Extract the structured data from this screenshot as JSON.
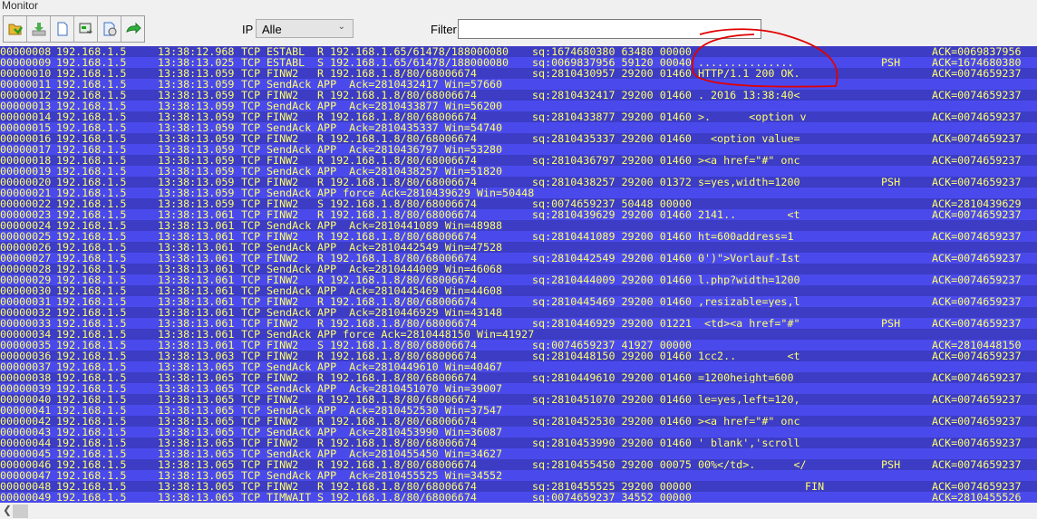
{
  "window": {
    "title": "Monitor"
  },
  "toolbar": {
    "buttons": [
      {
        "icon": "open-folder-icon"
      },
      {
        "icon": "download-icon"
      },
      {
        "icon": "new-document-icon"
      },
      {
        "icon": "export-icon"
      },
      {
        "icon": "properties-icon"
      },
      {
        "icon": "forward-arrow-icon"
      }
    ],
    "ip_label": "IP",
    "ip_value": "Alle",
    "filter_label": "Filter",
    "filter_value": ""
  },
  "colors": {
    "row_dark": "#3c3cc4",
    "row_light": "#4a4aec",
    "text": "#ffff70",
    "annotation": "#e00000"
  },
  "rows": [
    {
      "id": "00000008",
      "ip": "192.168.1.5",
      "time": "13:38:12.968",
      "proto": "TCP",
      "state": "ESTABL",
      "detail": "R 192.168.1.65/61478/188000080",
      "seq": "sq:1674680380 63480 00000",
      "flag": "",
      "ack": "ACK=0069837956"
    },
    {
      "id": "00000009",
      "ip": "192.168.1.5",
      "time": "13:38:13.025",
      "proto": "TCP",
      "state": "ESTABL",
      "detail": "S 192.168.1.65/61478/188000080",
      "seq": "sq:0069837956 59120 00040 ...............",
      "flag": "PSH",
      "ack": "ACK=1674680380"
    },
    {
      "id": "00000010",
      "ip": "192.168.1.5",
      "time": "13:38:13.059",
      "proto": "TCP",
      "state": "FINW2",
      "detail": "R 192.168.1.8/80/68006674",
      "seq": "sq:2810430957 29200 01460 HTTP/1.1 200 OK.",
      "flag": "",
      "ack": "ACK=0074659237"
    },
    {
      "id": "00000011",
      "ip": "192.168.1.5",
      "time": "13:38:13.059",
      "proto": "TCP",
      "state": "SendAck",
      "detail": "APP  Ack=2810432417 Win=57660",
      "seq": "",
      "flag": "",
      "ack": ""
    },
    {
      "id": "00000012",
      "ip": "192.168.1.5",
      "time": "13:38:13.059",
      "proto": "TCP",
      "state": "FINW2",
      "detail": "R 192.168.1.8/80/68006674",
      "seq": "sq:2810432417 29200 01460 . 2016 13:38:40<",
      "flag": "",
      "ack": "ACK=0074659237"
    },
    {
      "id": "00000013",
      "ip": "192.168.1.5",
      "time": "13:38:13.059",
      "proto": "TCP",
      "state": "SendAck",
      "detail": "APP  Ack=2810433877 Win=56200",
      "seq": "",
      "flag": "",
      "ack": ""
    },
    {
      "id": "00000014",
      "ip": "192.168.1.5",
      "time": "13:38:13.059",
      "proto": "TCP",
      "state": "FINW2",
      "detail": "R 192.168.1.8/80/68006674",
      "seq": "sq:2810433877 29200 01460 >.      <option v",
      "flag": "",
      "ack": "ACK=0074659237"
    },
    {
      "id": "00000015",
      "ip": "192.168.1.5",
      "time": "13:38:13.059",
      "proto": "TCP",
      "state": "SendAck",
      "detail": "APP  Ack=2810435337 Win=54740",
      "seq": "",
      "flag": "",
      "ack": ""
    },
    {
      "id": "00000016",
      "ip": "192.168.1.5",
      "time": "13:38:13.059",
      "proto": "TCP",
      "state": "FINW2",
      "detail": "R 192.168.1.8/80/68006674",
      "seq": "sq:2810435337 29200 01460   <option value=",
      "flag": "",
      "ack": "ACK=0074659237"
    },
    {
      "id": "00000017",
      "ip": "192.168.1.5",
      "time": "13:38:13.059",
      "proto": "TCP",
      "state": "SendAck",
      "detail": "APP  Ack=2810436797 Win=53280",
      "seq": "",
      "flag": "",
      "ack": ""
    },
    {
      "id": "00000018",
      "ip": "192.168.1.5",
      "time": "13:38:13.059",
      "proto": "TCP",
      "state": "FINW2",
      "detail": "R 192.168.1.8/80/68006674",
      "seq": "sq:2810436797 29200 01460 ><a href=\"#\" onc",
      "flag": "",
      "ack": "ACK=0074659237"
    },
    {
      "id": "00000019",
      "ip": "192.168.1.5",
      "time": "13:38:13.059",
      "proto": "TCP",
      "state": "SendAck",
      "detail": "APP  Ack=2810438257 Win=51820",
      "seq": "",
      "flag": "",
      "ack": ""
    },
    {
      "id": "00000020",
      "ip": "192.168.1.5",
      "time": "13:38:13.059",
      "proto": "TCP",
      "state": "FINW2",
      "detail": "R 192.168.1.8/80/68006674",
      "seq": "sq:2810438257 29200 01372 s=yes,width=1200",
      "flag": "PSH",
      "ack": "ACK=0074659237"
    },
    {
      "id": "00000021",
      "ip": "192.168.1.5",
      "time": "13:38:13.059",
      "proto": "TCP",
      "state": "SendAck",
      "detail": "APP force Ack=2810439629 Win=50448",
      "seq": "",
      "flag": "",
      "ack": ""
    },
    {
      "id": "00000022",
      "ip": "192.168.1.5",
      "time": "13:38:13.059",
      "proto": "TCP",
      "state": "FINW2",
      "detail": "S 192.168.1.8/80/68006674",
      "seq": "sq:0074659237 50448 00000",
      "flag": "",
      "ack": "ACK=2810439629"
    },
    {
      "id": "00000023",
      "ip": "192.168.1.5",
      "time": "13:38:13.061",
      "proto": "TCP",
      "state": "FINW2",
      "detail": "R 192.168.1.8/80/68006674",
      "seq": "sq:2810439629 29200 01460 2141..        <t",
      "flag": "",
      "ack": "ACK=0074659237"
    },
    {
      "id": "00000024",
      "ip": "192.168.1.5",
      "time": "13:38:13.061",
      "proto": "TCP",
      "state": "SendAck",
      "detail": "APP  Ack=2810441089 Win=48988",
      "seq": "",
      "flag": "",
      "ack": ""
    },
    {
      "id": "00000025",
      "ip": "192.168.1.5",
      "time": "13:38:13.061",
      "proto": "TCP",
      "state": "FINW2",
      "detail": "R 192.168.1.8/80/68006674",
      "seq": "sq:2810441089 29200 01460 ht=600address=1",
      "flag": "",
      "ack": "ACK=0074659237"
    },
    {
      "id": "00000026",
      "ip": "192.168.1.5",
      "time": "13:38:13.061",
      "proto": "TCP",
      "state": "SendAck",
      "detail": "APP  Ack=2810442549 Win=47528",
      "seq": "",
      "flag": "",
      "ack": ""
    },
    {
      "id": "00000027",
      "ip": "192.168.1.5",
      "time": "13:38:13.061",
      "proto": "TCP",
      "state": "FINW2",
      "detail": "R 192.168.1.8/80/68006674",
      "seq": "sq:2810442549 29200 01460 0')\">Vorlauf-Ist",
      "flag": "",
      "ack": "ACK=0074659237"
    },
    {
      "id": "00000028",
      "ip": "192.168.1.5",
      "time": "13:38:13.061",
      "proto": "TCP",
      "state": "SendAck",
      "detail": "APP  Ack=2810444009 Win=46068",
      "seq": "",
      "flag": "",
      "ack": ""
    },
    {
      "id": "00000029",
      "ip": "192.168.1.5",
      "time": "13:38:13.061",
      "proto": "TCP",
      "state": "FINW2",
      "detail": "R 192.168.1.8/80/68006674",
      "seq": "sq:2810444009 29200 01460 l.php?width=1200",
      "flag": "",
      "ack": "ACK=0074659237"
    },
    {
      "id": "00000030",
      "ip": "192.168.1.5",
      "time": "13:38:13.061",
      "proto": "TCP",
      "state": "SendAck",
      "detail": "APP  Ack=2810445469 Win=44608",
      "seq": "",
      "flag": "",
      "ack": ""
    },
    {
      "id": "00000031",
      "ip": "192.168.1.5",
      "time": "13:38:13.061",
      "proto": "TCP",
      "state": "FINW2",
      "detail": "R 192.168.1.8/80/68006674",
      "seq": "sq:2810445469 29200 01460 ,resizable=yes,l",
      "flag": "",
      "ack": "ACK=0074659237"
    },
    {
      "id": "00000032",
      "ip": "192.168.1.5",
      "time": "13:38:13.061",
      "proto": "TCP",
      "state": "SendAck",
      "detail": "APP  Ack=2810446929 Win=43148",
      "seq": "",
      "flag": "",
      "ack": ""
    },
    {
      "id": "00000033",
      "ip": "192.168.1.5",
      "time": "13:38:13.061",
      "proto": "TCP",
      "state": "FINW2",
      "detail": "R 192.168.1.8/80/68006674",
      "seq": "sq:2810446929 29200 01221  <td><a href=\"#\"",
      "flag": "PSH",
      "ack": "ACK=0074659237"
    },
    {
      "id": "00000034",
      "ip": "192.168.1.5",
      "time": "13:38:13.061",
      "proto": "TCP",
      "state": "SendAck",
      "detail": "APP force Ack=2810448150 Win=41927",
      "seq": "",
      "flag": "",
      "ack": ""
    },
    {
      "id": "00000035",
      "ip": "192.168.1.5",
      "time": "13:38:13.061",
      "proto": "TCP",
      "state": "FINW2",
      "detail": "S 192.168.1.8/80/68006674",
      "seq": "sq:0074659237 41927 00000",
      "flag": "",
      "ack": "ACK=2810448150"
    },
    {
      "id": "00000036",
      "ip": "192.168.1.5",
      "time": "13:38:13.063",
      "proto": "TCP",
      "state": "FINW2",
      "detail": "R 192.168.1.8/80/68006674",
      "seq": "sq:2810448150 29200 01460 1cc2..        <t",
      "flag": "",
      "ack": "ACK=0074659237"
    },
    {
      "id": "00000037",
      "ip": "192.168.1.5",
      "time": "13:38:13.065",
      "proto": "TCP",
      "state": "SendAck",
      "detail": "APP  Ack=2810449610 Win=40467",
      "seq": "",
      "flag": "",
      "ack": ""
    },
    {
      "id": "00000038",
      "ip": "192.168.1.5",
      "time": "13:38:13.065",
      "proto": "TCP",
      "state": "FINW2",
      "detail": "R 192.168.1.8/80/68006674",
      "seq": "sq:2810449610 29200 01460 =1200height=600",
      "flag": "",
      "ack": "ACK=0074659237"
    },
    {
      "id": "00000039",
      "ip": "192.168.1.5",
      "time": "13:38:13.065",
      "proto": "TCP",
      "state": "SendAck",
      "detail": "APP  Ack=2810451070 Win=39007",
      "seq": "",
      "flag": "",
      "ack": ""
    },
    {
      "id": "00000040",
      "ip": "192.168.1.5",
      "time": "13:38:13.065",
      "proto": "TCP",
      "state": "FINW2",
      "detail": "R 192.168.1.8/80/68006674",
      "seq": "sq:2810451070 29200 01460 le=yes,left=120,",
      "flag": "",
      "ack": "ACK=0074659237"
    },
    {
      "id": "00000041",
      "ip": "192.168.1.5",
      "time": "13:38:13.065",
      "proto": "TCP",
      "state": "SendAck",
      "detail": "APP  Ack=2810452530 Win=37547",
      "seq": "",
      "flag": "",
      "ack": ""
    },
    {
      "id": "00000042",
      "ip": "192.168.1.5",
      "time": "13:38:13.065",
      "proto": "TCP",
      "state": "FINW2",
      "detail": "R 192.168.1.8/80/68006674",
      "seq": "sq:2810452530 29200 01460 ><a href=\"#\" onc",
      "flag": "",
      "ack": "ACK=0074659237"
    },
    {
      "id": "00000043",
      "ip": "192.168.1.5",
      "time": "13:38:13.065",
      "proto": "TCP",
      "state": "SendAck",
      "detail": "APP  Ack=2810453990 Win=36087",
      "seq": "",
      "flag": "",
      "ack": ""
    },
    {
      "id": "00000044",
      "ip": "192.168.1.5",
      "time": "13:38:13.065",
      "proto": "TCP",
      "state": "FINW2",
      "detail": "R 192.168.1.8/80/68006674",
      "seq": "sq:2810453990 29200 01460 '_blank','scroll",
      "flag": "",
      "ack": "ACK=0074659237"
    },
    {
      "id": "00000045",
      "ip": "192.168.1.5",
      "time": "13:38:13.065",
      "proto": "TCP",
      "state": "SendAck",
      "detail": "APP  Ack=2810455450 Win=34627",
      "seq": "",
      "flag": "",
      "ack": ""
    },
    {
      "id": "00000046",
      "ip": "192.168.1.5",
      "time": "13:38:13.065",
      "proto": "TCP",
      "state": "FINW2",
      "detail": "R 192.168.1.8/80/68006674",
      "seq": "sq:2810455450 29200 00075 00%</td>.      </",
      "flag": "PSH",
      "ack": "ACK=0074659237"
    },
    {
      "id": "00000047",
      "ip": "192.168.1.5",
      "time": "13:38:13.065",
      "proto": "TCP",
      "state": "SendAck",
      "detail": "APP  Ack=2810455525 Win=34552",
      "seq": "",
      "flag": "",
      "ack": ""
    },
    {
      "id": "00000048",
      "ip": "192.168.1.5",
      "time": "13:38:13.065",
      "proto": "TCP",
      "state": "FINW2",
      "detail": "R 192.168.1.8/80/68006674",
      "seq": "sq:2810455525 29200 00000",
      "flag": "FIN",
      "ack": "ACK=0074659237"
    },
    {
      "id": "00000049",
      "ip": "192.168.1.5",
      "time": "13:38:13.065",
      "proto": "TCP",
      "state": "TIMWAIT",
      "detail": "S 192.168.1.8/80/68006674",
      "seq": "sq:0074659237 34552 00000",
      "flag": "",
      "ack": "ACK=2810455526"
    }
  ]
}
